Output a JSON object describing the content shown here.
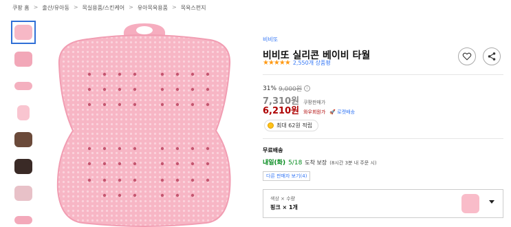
{
  "breadcrumb": [
    "쿠팡 홈",
    "출산/유아동",
    "목실용품/스킨케어",
    "유아목욕용품",
    "목욕스펀지"
  ],
  "thumbnails": [
    {
      "label": "thumbnail-1",
      "color": "#f7b8c6"
    },
    {
      "label": "thumbnail-2",
      "color": "#f2a7b8"
    },
    {
      "label": "thumbnail-3",
      "color": "#f4b0bf"
    },
    {
      "label": "thumbnail-4",
      "color": "#f9c5d0"
    },
    {
      "label": "thumbnail-5",
      "color": "#6b4a3a"
    },
    {
      "label": "thumbnail-6",
      "color": "#3a2a26"
    },
    {
      "label": "thumbnail-7",
      "color": "#e8c1c8"
    },
    {
      "label": "thumbnail-8",
      "color": "#f3a9ba"
    }
  ],
  "product": {
    "brand": "비비또",
    "title": "비비또 실리콘 베이비 타월",
    "stars": "★★★★★",
    "reviews": "2,550개 상품평",
    "discount": "31%",
    "original_price": "9,000원",
    "coupang_price": "7,310원",
    "coupang_label": "쿠팡판매가",
    "wow_price": "6,210원",
    "wow_label": "와우회원가",
    "rocket_label": "로켓배송",
    "reward": "최대 62원 적립"
  },
  "shipping": {
    "title": "무료배송",
    "day": "내일(화)",
    "date": "5/18",
    "guarantee": "도착 보장",
    "note": "(8시간 3분 내 주문 시)"
  },
  "sellers_link": "다른 판매자 보기(4)",
  "option": {
    "label": "색상 × 수량",
    "value": "핑크 × 1개"
  },
  "colors": {
    "accent_blue": "#3477f5",
    "price_red": "#ae0000",
    "product_pink": "#f7b3c3",
    "delivery_green": "#00891a"
  },
  "icons": {
    "heart": "heart-icon",
    "share": "share-icon",
    "info": "info-icon",
    "coin": "coin-icon",
    "dropdown": "chevron-down-icon"
  }
}
